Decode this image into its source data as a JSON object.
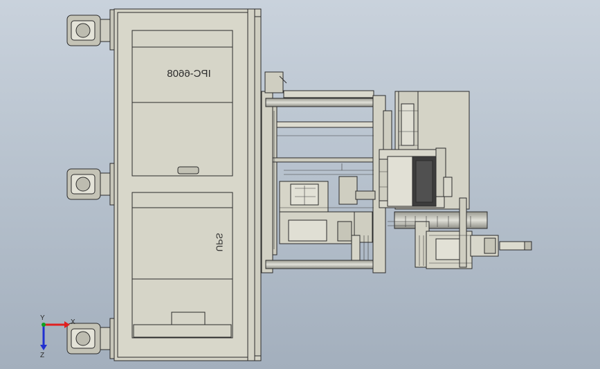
{
  "labels": {
    "ipc": "IPC-6608",
    "ups": "UPS"
  },
  "triad": {
    "x": "X",
    "y": "Y",
    "z": "Z"
  },
  "colors": {
    "background": "#b8c2ce",
    "body": "#d6d5c8",
    "line": "#2a2a2a",
    "axis_x": "#e02020",
    "axis_y": "#10a020",
    "axis_z": "#2030d0"
  }
}
